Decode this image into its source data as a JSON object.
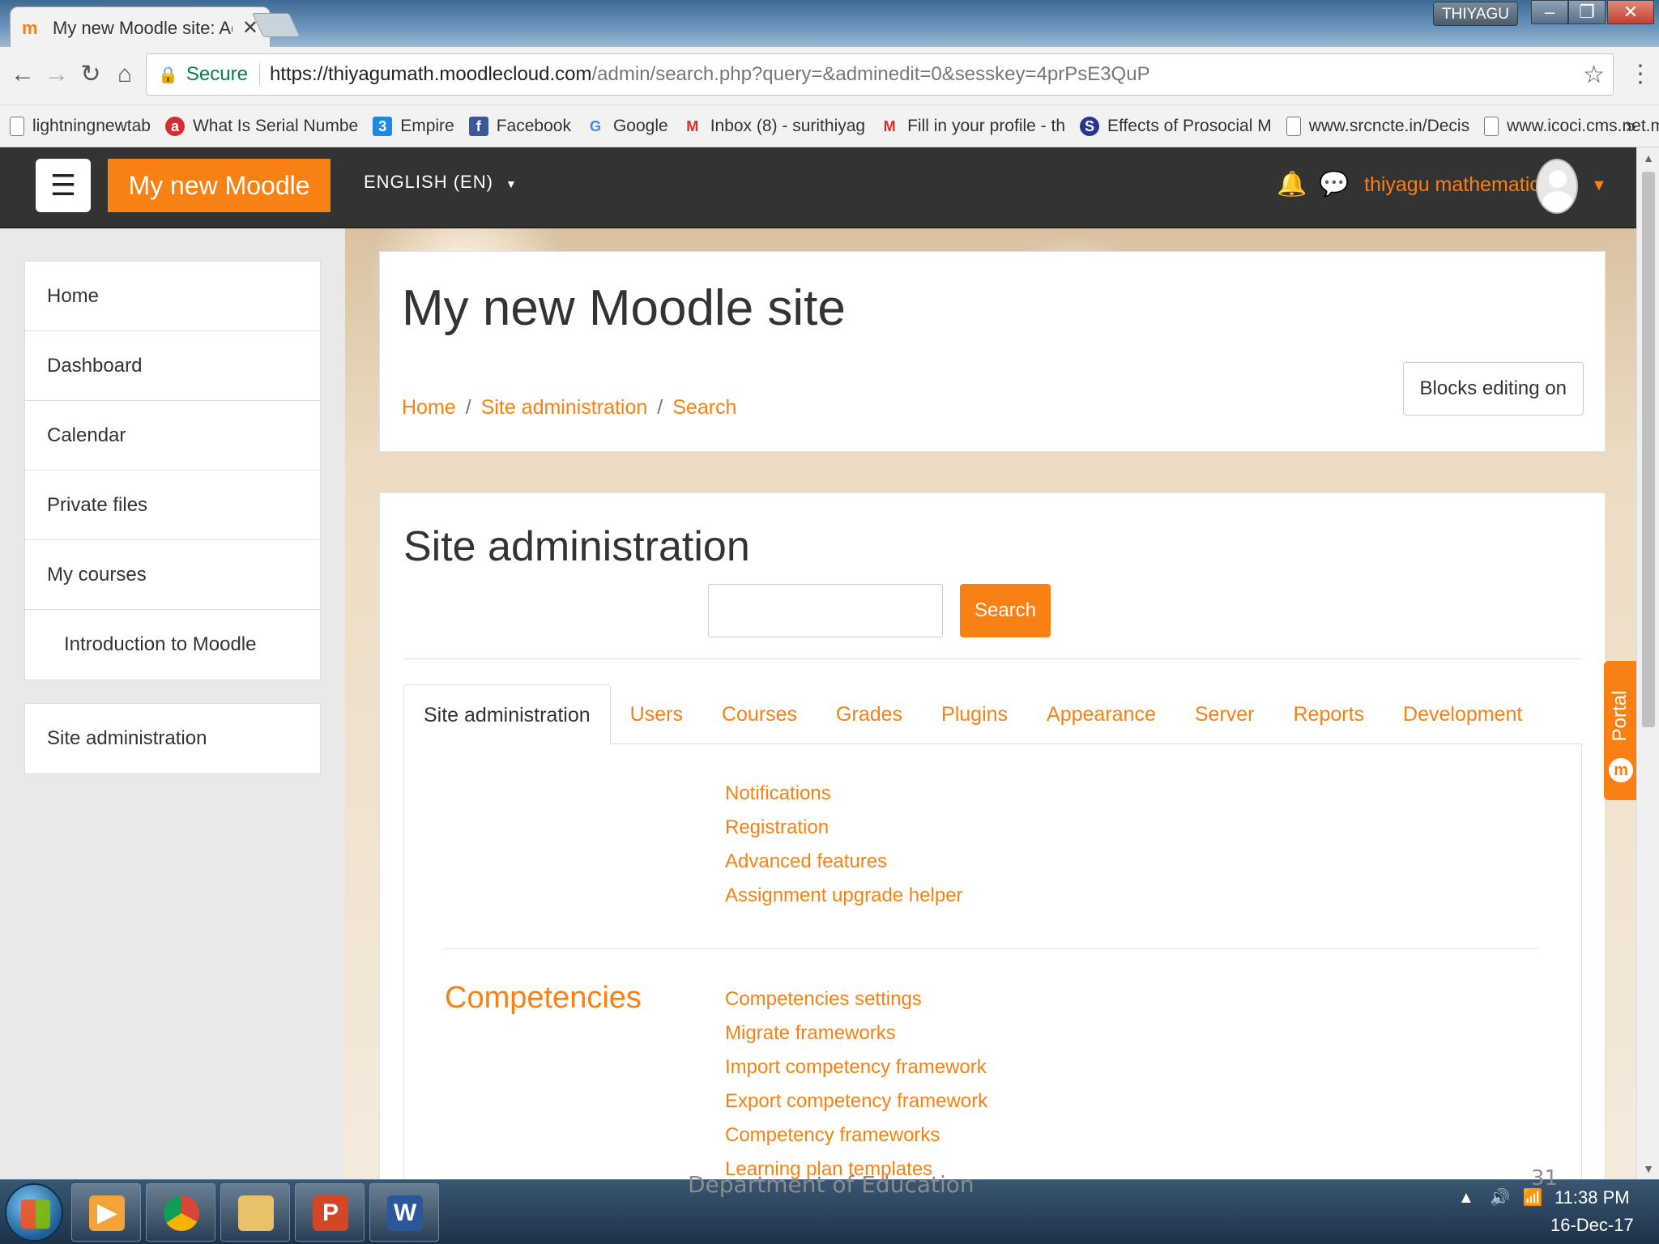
{
  "browser": {
    "tab_title": "My new Moodle site: Adm",
    "tab_close": "✕",
    "windows_user": "THIYAGU",
    "nav": {
      "back": "←",
      "forward": "→",
      "reload": "↻",
      "home": "⌂"
    },
    "secure_label": "Secure",
    "url_host": "https://thiyagumath.moodlecloud.com",
    "url_path": "/admin/search.php?query=&adminedit=0&sesskey=4prPsE3QuP",
    "bookmarks": [
      {
        "label": "lightningnewtab",
        "icon": "page-icon"
      },
      {
        "label": "What Is Serial Numbe",
        "icon": "ask-icon"
      },
      {
        "label": "Empire",
        "icon": "empire-icon"
      },
      {
        "label": "Facebook",
        "icon": "facebook-icon"
      },
      {
        "label": "Google",
        "icon": "google-icon"
      },
      {
        "label": "Inbox (8) - surithiyag",
        "icon": "gmail-icon"
      },
      {
        "label": "Fill in your profile - th",
        "icon": "gmail-icon"
      },
      {
        "label": "Effects of Prosocial M",
        "icon": "s-icon"
      },
      {
        "label": "www.srcncte.in/Decis",
        "icon": "page-icon"
      },
      {
        "label": "www.icoci.cms.net.my",
        "icon": "page-icon"
      }
    ],
    "bookmarks_more": "»"
  },
  "navbar": {
    "menu_glyph": "☰",
    "brand": "My new Moodle site",
    "language": "ENGLISH (EN)",
    "username": "thiyagu mathematics",
    "accent": "#f98012"
  },
  "sidebar": {
    "items": [
      {
        "label": "Home"
      },
      {
        "label": "Dashboard"
      },
      {
        "label": "Calendar"
      },
      {
        "label": "Private files"
      },
      {
        "label": "My courses"
      },
      {
        "label": "Introduction to Moodle"
      }
    ],
    "admin_item": "Site administration"
  },
  "header": {
    "title": "My new Moodle site",
    "breadcrumb": [
      "Home",
      "Site administration",
      "Search"
    ],
    "breadcrumb_sep": "/",
    "blocks_button": "Blocks editing on"
  },
  "admin": {
    "title": "Site administration",
    "search_value": "",
    "search_button": "Search",
    "tabs": [
      "Site administration",
      "Users",
      "Courses",
      "Grades",
      "Plugins",
      "Appearance",
      "Server",
      "Reports",
      "Development"
    ],
    "general_links": [
      "Notifications",
      "Registration",
      "Advanced features",
      "Assignment upgrade helper"
    ],
    "competencies_title": "Competencies",
    "competencies_links": [
      "Competencies settings",
      "Migrate frameworks",
      "Import competency framework",
      "Export competency framework",
      "Competency frameworks",
      "Learning plan templates"
    ]
  },
  "portal": {
    "label": "Portal"
  },
  "slide": {
    "footer": "Department of Education",
    "number": "31"
  },
  "taskbar": {
    "time": "11:38 PM",
    "date": "16-Dec-17"
  }
}
